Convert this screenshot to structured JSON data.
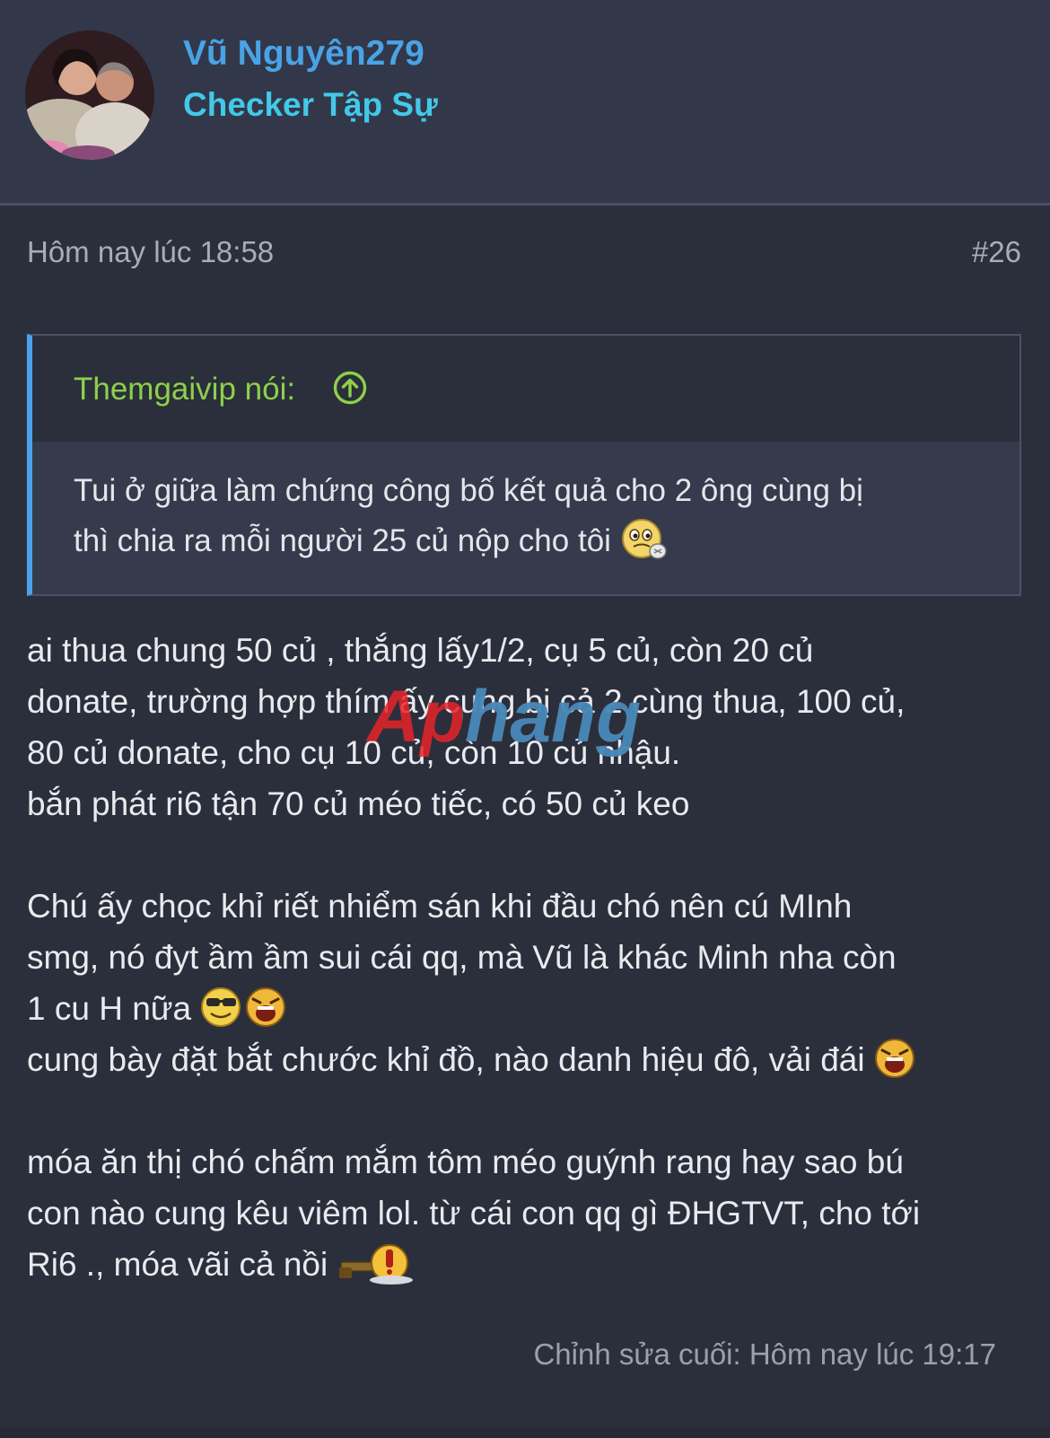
{
  "author": {
    "name": "Vũ Nguyên279",
    "title": "Checker Tập Sự"
  },
  "post": {
    "time": "Hôm nay lúc 18:58",
    "number": "#26",
    "edited": "Chỉnh sửa cuối: Hôm nay lúc 19:17"
  },
  "quote": {
    "author": "Themgaivip nói:",
    "line1": "Tui ở giữa làm chứng công bố kết quả cho 2 ông cùng bị",
    "line2": "thì chia ra mỗi người 25 củ nộp cho tôi"
  },
  "message": {
    "p1": "ai thua chung 50 củ , thắng lấy1/2, cụ 5 củ, còn 20 củ\ndonate, trường hợp thím ấy cung bị cả 2 cùng thua, 100 củ,\n80 củ donate, cho cụ 10 củ, còn 10 củ nhậu.\nbắn phát ri6 tận 70 củ méo tiếc, có 50 củ keo",
    "p2a": "Chú ấy chọc khỉ riết nhiểm sán khi đầu chó nên cú MInh\nsmg, nó đyt ầm ầm sui cái qq, mà Vũ là khác Minh nha còn\n1 cu H nữa",
    "p2b": "cung bày đặt bắt chước khỉ đồ, nào danh hiệu đô, vải đái",
    "p3": "móa ăn thị chó chấm mắm tôm méo guýnh rang hay sao bú\ncon nào cung kêu viêm lol. từ cái con qq gì ĐHGTVT, cho tới\nRi6 ., móa vãi cả nồi"
  },
  "watermark": "Aphang",
  "colors": {
    "background": "#2b2f3b",
    "header_bg": "#323849",
    "username": "#49a3e6",
    "usertitle": "#43c8e8",
    "quote_author": "#8ed04a",
    "quote_border": "#4aa3ea"
  }
}
